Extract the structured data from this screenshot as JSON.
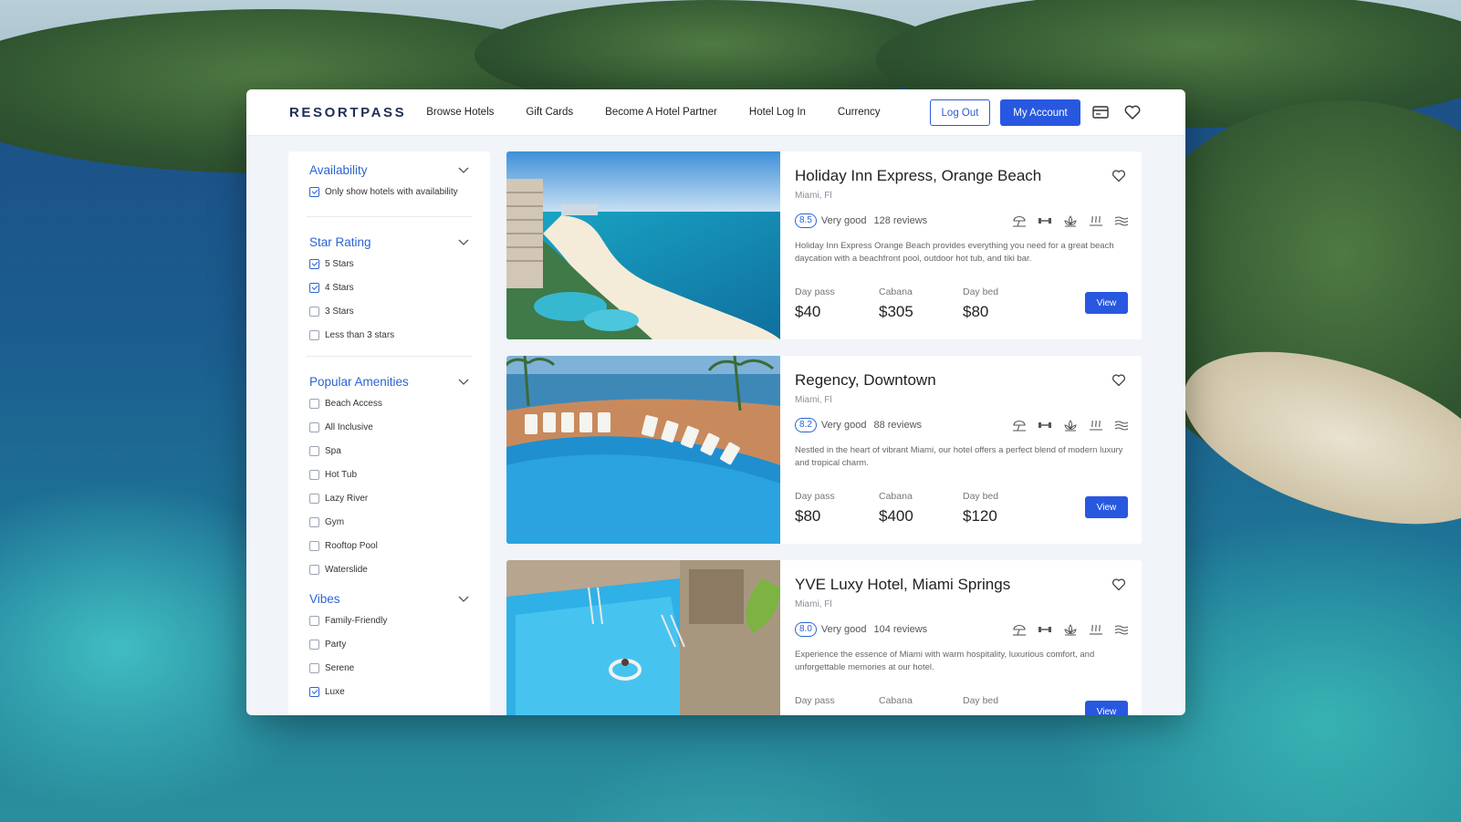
{
  "brand": {
    "logo": "RESORTPASS"
  },
  "nav": {
    "items": [
      "Browse Hotels",
      "Gift Cards",
      "Become A Hotel Partner",
      "Hotel Log In",
      "Currency"
    ],
    "logout_label": "Log Out",
    "account_label": "My Account",
    "icons": [
      "card-icon",
      "heart-icon"
    ]
  },
  "filters": {
    "availability": {
      "title": "Availability",
      "options": [
        {
          "label": "Only show hotels with availability",
          "checked": true
        }
      ]
    },
    "star_rating": {
      "title": "Star Rating",
      "options": [
        {
          "label": "5 Stars",
          "checked": true
        },
        {
          "label": "4 Stars",
          "checked": true
        },
        {
          "label": "3 Stars",
          "checked": false
        },
        {
          "label": "Less than 3 stars",
          "checked": false
        }
      ]
    },
    "amenities": {
      "title": "Popular Amenities",
      "options": [
        {
          "label": "Beach Access",
          "checked": false
        },
        {
          "label": "All Inclusive",
          "checked": false
        },
        {
          "label": "Spa",
          "checked": false
        },
        {
          "label": "Hot Tub",
          "checked": false
        },
        {
          "label": "Lazy River",
          "checked": false
        },
        {
          "label": "Gym",
          "checked": false
        },
        {
          "label": "Rooftop Pool",
          "checked": false
        },
        {
          "label": "Waterslide",
          "checked": false
        }
      ]
    },
    "vibes": {
      "title": "Vibes",
      "options": [
        {
          "label": "Family-Friendly",
          "checked": false
        },
        {
          "label": "Party",
          "checked": false
        },
        {
          "label": "Serene",
          "checked": false
        },
        {
          "label": "Luxe",
          "checked": true
        }
      ]
    }
  },
  "hotels": [
    {
      "name": "Holiday Inn Express, Orange Beach",
      "location": "Miami, Fl",
      "score": "8.5",
      "rating_label": "Very good",
      "reviews": "128 reviews",
      "description": "Holiday Inn Express Orange Beach provides everything you need for a great beach daycation with a beachfront pool, outdoor hot tub, and tiki bar.",
      "prices": [
        {
          "label": "Day pass",
          "value": "$40"
        },
        {
          "label": "Cabana",
          "value": "$305"
        },
        {
          "label": "Day bed",
          "value": "$80"
        }
      ],
      "view_label": "View",
      "photo": "beach-resort-photo"
    },
    {
      "name": "Regency, Downtown",
      "location": "Miami, Fl",
      "score": "8.2",
      "rating_label": "Very good",
      "reviews": "88 reviews",
      "description": "Nestled in the heart of vibrant Miami, our hotel offers a perfect blend of modern luxury and tropical charm.",
      "prices": [
        {
          "label": "Day pass",
          "value": "$80"
        },
        {
          "label": "Cabana",
          "value": "$400"
        },
        {
          "label": "Day bed",
          "value": "$120"
        }
      ],
      "view_label": "View",
      "photo": "pool-loungers-photo"
    },
    {
      "name": "YVE Luxy Hotel, Miami Springs",
      "location": "Miami, Fl",
      "score": "8.0",
      "rating_label": "Very good",
      "reviews": "104 reviews",
      "description": "Experience the essence of Miami with warm hospitality, luxurious comfort, and unforgettable memories at our hotel.",
      "prices": [
        {
          "label": "Day pass",
          "value": ""
        },
        {
          "label": "Cabana",
          "value": ""
        },
        {
          "label": "Day bed",
          "value": ""
        }
      ],
      "view_label": "View",
      "photo": "pool-float-photo"
    }
  ],
  "amenity_icons": [
    "beach-umbrella-icon",
    "gym-icon",
    "spa-icon",
    "hot-tub-icon",
    "waves-icon"
  ],
  "colors": {
    "accent": "#2858e0",
    "link": "#2a64d4",
    "logo": "#1e2f56"
  }
}
